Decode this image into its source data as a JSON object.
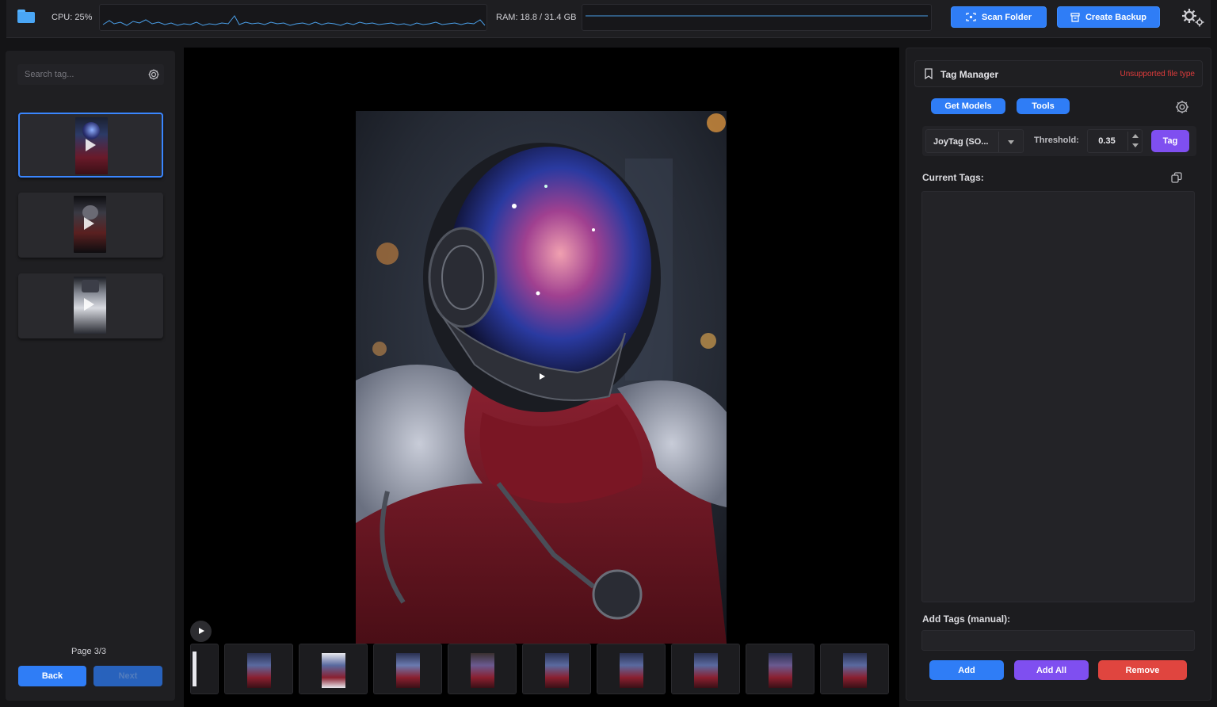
{
  "topbar": {
    "cpu_label": "CPU: 25%",
    "ram_label": "RAM: 18.8 / 31.4 GB",
    "scan_label": "Scan Folder",
    "backup_label": "Create Backup"
  },
  "sidebar": {
    "search_placeholder": "Search tag...",
    "page_label": "Page 3/3",
    "back_label": "Back",
    "next_label": "Next",
    "items": [
      {
        "selected": true
      },
      {
        "selected": false
      },
      {
        "selected": false
      }
    ]
  },
  "viewer": {
    "filmstrip_count": 10
  },
  "tag_manager": {
    "title": "Tag Manager",
    "warning": "Unsupported file type",
    "get_models_label": "Get Models",
    "tools_label": "Tools",
    "model_value": "JoyTag (SO...",
    "threshold_label": "Threshold:",
    "threshold_value": "0.35",
    "tag_label": "Tag",
    "current_tags_label": "Current Tags:",
    "current_tags": [],
    "add_tags_label": "Add Tags (manual):",
    "add_label": "Add",
    "add_all_label": "Add All",
    "remove_label": "Remove"
  },
  "colors": {
    "accent_blue": "#2f7df6",
    "accent_purple": "#7f4ff0",
    "danger_red": "#e0453f",
    "warning_text": "#e03c3c"
  }
}
